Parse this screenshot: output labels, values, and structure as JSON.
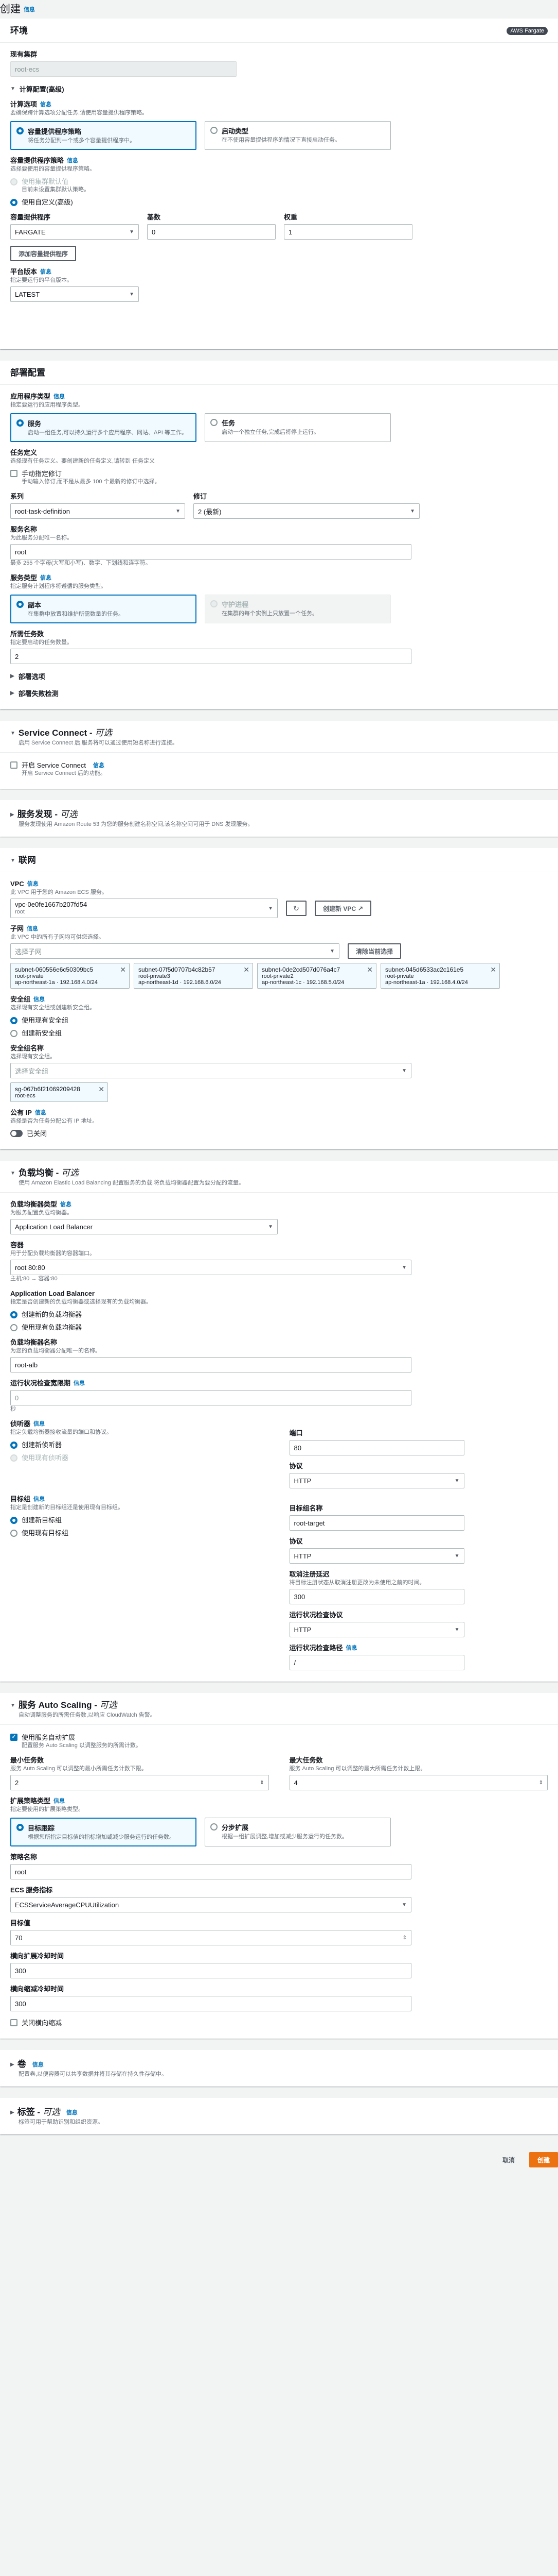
{
  "page": {
    "title": "创建",
    "info": "信息"
  },
  "env": {
    "title": "环境",
    "badge": "AWS Fargate",
    "cluster_label": "现有集群",
    "cluster_value": "root-ecs",
    "compute_toggle": "计算配置(高级)",
    "compute_options_label": "计算选项",
    "compute_options_desc": "要确保跨计算选项分配任务,请使用容量提供程序策略。",
    "tile_capacity_title": "容量提供程序策略",
    "tile_capacity_desc": "将任务分配到一个或多个容量提供程序中。",
    "tile_launch_title": "启动类型",
    "tile_launch_desc": "在不使用容量提供程序的情况下直接启动任务。",
    "cps_label": "容量提供程序策略",
    "cps_desc": "选择要使用的容量提供程序策略。",
    "cps_opt1": "使用集群默认值",
    "cps_opt1_desc": "目前未设置集群默认策略。",
    "cps_opt2": "使用自定义(高级)",
    "col_provider": "容量提供程序",
    "col_base": "基数",
    "col_weight": "权重",
    "provider_value": "FARGATE",
    "base_value": "0",
    "weight_value": "1",
    "add_provider": "添加容量提供程序",
    "platform_label": "平台版本",
    "platform_desc": "指定要运行的平台版本。",
    "platform_value": "LATEST"
  },
  "deploy": {
    "title": "部署配置",
    "apptype_label": "应用程序类型",
    "apptype_desc": "指定要运行的应用程序类型。",
    "tile_service_title": "服务",
    "tile_service_desc": "启动一组任务,可以持久运行多个应用程序、网站、API 等工作。",
    "tile_task_title": "任务",
    "tile_task_desc": "启动一个独立任务,完成后将停止运行。",
    "taskdef_label": "任务定义",
    "taskdef_desc": "选择现有任务定义。要创建新的任务定义,请转到 任务定义",
    "manual_rev": "手动指定修订",
    "manual_rev_desc": "手动输入修订,而不是从最多 100 个最新的修订中选择。",
    "family_label": "系列",
    "family_value": "root-task-definition",
    "revision_label": "修订",
    "revision_value": "2 (最新)",
    "svcname_label": "服务名称",
    "svcname_desc": "为此服务分配唯一名称。",
    "svcname_value": "root",
    "svcname_hint": "最多 255 个字母(大写和小写)、数字、下划线和连字符。",
    "svctype_label": "服务类型",
    "svctype_desc": "指定服务计划程序将遵循的服务类型。",
    "tile_replica_title": "副本",
    "tile_replica_desc": "在集群中放置和维护所需数量的任务。",
    "tile_daemon_title": "守护进程",
    "tile_daemon_desc": "在集群的每个实例上只放置一个任务。",
    "desired_label": "所需任务数",
    "desired_desc": "指定要启动的任务数量。",
    "desired_value": "2",
    "deploy_options": "部署选项",
    "failure_detect": "部署失败检测"
  },
  "svcconnect": {
    "title": "Service Connect - ",
    "optional": "可选",
    "desc": "启用 Service Connect 后,服务将可以通过使用短名称进行连接。",
    "enable": "开启 Service Connect",
    "info": "信息",
    "enable_desc": "开启 Service Connect 后的功能。"
  },
  "discovery": {
    "title": "服务发现 - ",
    "optional": "可选",
    "desc": "服务发现使用 Amazon Route 53 为您的服务创建名称空间,该名称空间可用于 DNS 发现服务。"
  },
  "network": {
    "title": "联网",
    "vpc_label": "VPC",
    "vpc_desc": "此 VPC 用于您的 Amazon ECS 服务。",
    "vpc_value": "vpc-0e0fe1667b207fd54",
    "vpc_sub": "root",
    "create_vpc": "创建新 VPC",
    "subnet_label": "子网",
    "subnet_desc": "此 VPC 中的所有子网均可供您选择。",
    "subnet_placeholder": "选择子网",
    "clear_subnets": "清除当前选择",
    "subnets": [
      {
        "id": "subnet-060556e6c50309bc5",
        "name": "root-private",
        "az": "ap-northeast-1a",
        "cidr": "192.168.4.0/24"
      },
      {
        "id": "subnet-07f5d0707b4c82b57",
        "name": "root-private3",
        "az": "ap-northeast-1d",
        "cidr": "192.168.6.0/24"
      },
      {
        "id": "subnet-0de2cd507d076a4c7",
        "name": "root-private2",
        "az": "ap-northeast-1c",
        "cidr": "192.168.5.0/24"
      },
      {
        "id": "subnet-045d6533ac2c161e5",
        "name": "root-private",
        "az": "ap-northeast-1a",
        "cidr": "192.168.4.0/24"
      }
    ],
    "sg_label": "安全组",
    "sg_desc": "选择现有安全组或创建新安全组。",
    "sg_opt1": "使用现有安全组",
    "sg_opt2": "创建新安全组",
    "sgname_label": "安全组名称",
    "sgname_desc": "选择现有安全组。",
    "sgname_placeholder": "选择安全组",
    "sg_token_id": "sg-067b6f21069209428",
    "sg_token_name": "root-ecs",
    "pubip_label": "公有 IP",
    "pubip_desc": "选择是否为任务分配公有 IP 地址。",
    "pubip_value": "已关闭"
  },
  "lb": {
    "title": "负载均衡 - ",
    "optional": "可选",
    "desc": "使用 Amazon Elastic Load Balancing 配置服务的负载,将负载均衡器配置为要分配的流量。",
    "type_label": "负载均衡器类型",
    "type_desc": "为服务配置负载均衡器。",
    "type_value": "Application Load Balancer",
    "container_label": "容器",
    "container_desc": "用于分配负载均衡器的容器端口。",
    "container_value": "root 80:80",
    "container_hint": "主机:80 → 容器:80",
    "alb_label": "Application Load Balancer",
    "alb_desc": "指定是否创建新的负载均衡器或选择现有的负载均衡器。",
    "alb_opt1": "创建新的负载均衡器",
    "alb_opt2": "使用现有负载均衡器",
    "lbname_label": "负载均衡器名称",
    "lbname_desc": "为您的负载均衡器分配唯一的名称。",
    "lbname_value": "root-alb",
    "grace_label": "运行状况检查宽限期",
    "grace_desc": "",
    "grace_value": "0",
    "grace_unit": "秒",
    "listener_label": "侦听器",
    "listener_desc": "指定负载均衡器接收流量的端口和协议。",
    "listener_opt1": "创建新侦听器",
    "listener_opt2": "使用现有侦听器",
    "port_label": "端口",
    "port_value": "80",
    "proto_label": "协议",
    "proto_value": "HTTP",
    "tg_label": "目标组",
    "tg_desc": "指定是创建新的目标组还是使用现有目标组。",
    "tg_opt1": "创建新目标组",
    "tg_opt2": "使用现有目标组",
    "tgname_label": "目标组名称",
    "tgname_value": "root-target",
    "tgproto_label": "协议",
    "tgproto_value": "HTTP",
    "dereg_label": "取消注册延迟",
    "dereg_desc": "将目标注册状态从取消注册更改为未使用之前的时间。",
    "dereg_value": "300",
    "hcproto_label": "运行状况检查协议",
    "hcproto_value": "HTTP",
    "hcpath_label": "运行状况检查路径",
    "hcpath_value": "/"
  },
  "autoscaling": {
    "title": "服务 Auto Scaling - ",
    "optional": "可选",
    "desc": "自动调整服务的所需任务数,以响应 CloudWatch 告警。",
    "use": "使用服务自动扩展",
    "use_desc": "配置服务 Auto Scaling 以调整服务的所需计数。",
    "min_label": "最小任务数",
    "min_desc": "服务 Auto Scaling 可以调整的最小所需任务计数下限。",
    "min_value": "2",
    "max_label": "最大任务数",
    "max_desc": "服务 Auto Scaling 可以调整的最大所需任务计数上限。",
    "max_value": "4",
    "policy_label": "扩展策略类型",
    "policy_desc": "指定要使用的扩展策略类型。",
    "tile_target_title": "目标跟踪",
    "tile_target_desc": "根据您所指定目标值的指标增加或减少服务运行的任务数。",
    "tile_step_title": "分步扩展",
    "tile_step_desc": "根据一组扩展调整,增加或减少服务运行的任务数。",
    "pname_label": "策略名称",
    "pname_value": "root",
    "metric_label": "ECS 服务指标",
    "metric_value": "ECSServiceAverageCPUUtilization",
    "target_label": "目标值",
    "target_value": "70",
    "out_label": "横向扩展冷却时间",
    "out_value": "300",
    "in_label": "横向缩减冷却时间",
    "in_value": "300",
    "disable_in": "关闭横向缩减"
  },
  "volume": {
    "title": "卷",
    "desc": "配置卷,以便容器可以共享数据并将其存储在持久性存储中。"
  },
  "tags": {
    "title": "标签 - ",
    "optional": "可选",
    "desc": "标签可用于帮助识别和组织资源。"
  },
  "footer": {
    "cancel": "取消",
    "create": "创建"
  }
}
